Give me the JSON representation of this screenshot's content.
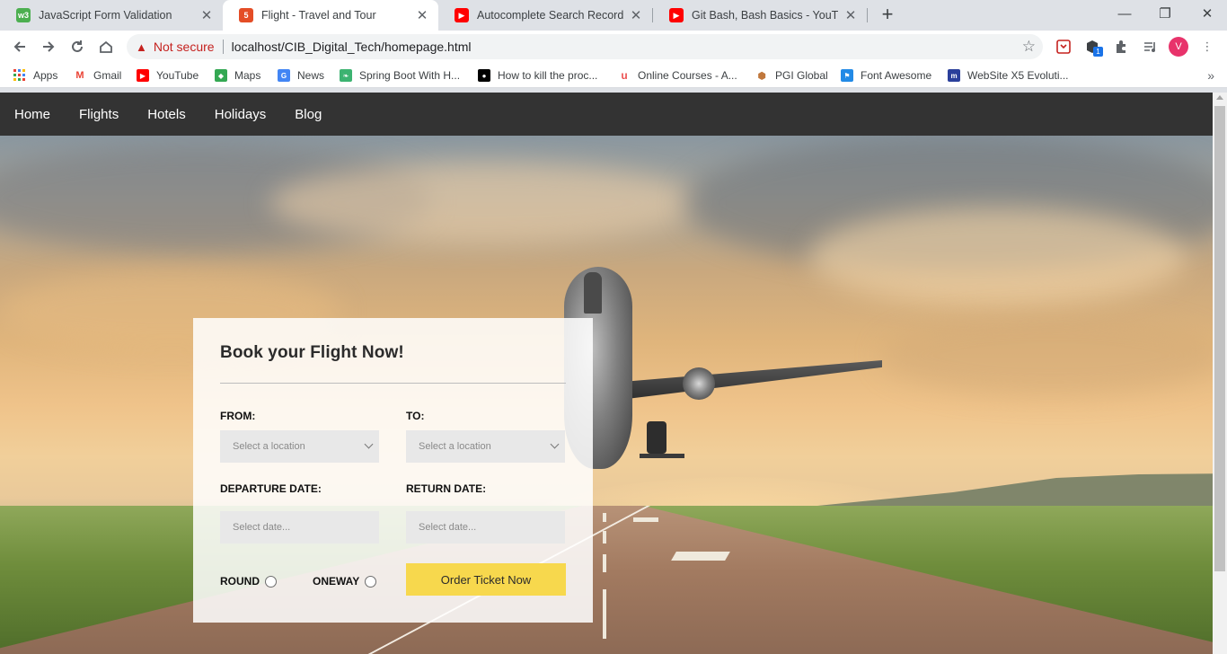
{
  "browser": {
    "tabs": [
      {
        "title": "JavaScript Form Validation",
        "favicon": "w3schools-icon",
        "active": false
      },
      {
        "title": "Flight - Travel and Tour",
        "favicon": "html5-icon",
        "active": true
      },
      {
        "title": "Autocomplete Search Record Fro",
        "favicon": "youtube-icon",
        "active": false
      },
      {
        "title": "Git Bash, Bash Basics - YouTube",
        "favicon": "youtube-icon",
        "active": false
      }
    ],
    "address_bar": {
      "security_text": "Not secure",
      "url": "localhost/CIB_Digital_Tech/homepage.html"
    },
    "extension_badge": "1",
    "profile_initial": "V",
    "bookmarks": [
      {
        "label": "Apps",
        "icon": "apps-grid-icon"
      },
      {
        "label": "Gmail",
        "icon": "gmail-icon"
      },
      {
        "label": "YouTube",
        "icon": "youtube-icon"
      },
      {
        "label": "Maps",
        "icon": "maps-icon"
      },
      {
        "label": "News",
        "icon": "news-icon"
      },
      {
        "label": "Spring Boot With H...",
        "icon": "spring-icon"
      },
      {
        "label": "How to kill the proc...",
        "icon": "medium-icon"
      },
      {
        "label": "Online Courses - A...",
        "icon": "udemy-icon"
      },
      {
        "label": "PGI Global",
        "icon": "pgi-icon"
      },
      {
        "label": "Font Awesome",
        "icon": "flag-icon"
      },
      {
        "label": "WebSite X5 Evoluti...",
        "icon": "websitex5-icon"
      }
    ]
  },
  "page": {
    "nav": [
      "Home",
      "Flights",
      "Hotels",
      "Holidays",
      "Blog"
    ],
    "booking": {
      "title": "Book your Flight Now!",
      "from_label": "FROM:",
      "to_label": "TO:",
      "from_placeholder": "Select a location",
      "to_placeholder": "Select a location",
      "departure_label": "DEPARTURE DATE:",
      "return_label": "RETURN DATE:",
      "departure_placeholder": "Select date...",
      "return_placeholder": "Select date...",
      "round_label": "ROUND",
      "oneway_label": "ONEWAY",
      "order_button": "Order Ticket Now"
    }
  },
  "colors": {
    "navbar": "#333333",
    "order_button": "#f7d84d",
    "not_secure": "#c5221f",
    "avatar": "#e8336b"
  }
}
